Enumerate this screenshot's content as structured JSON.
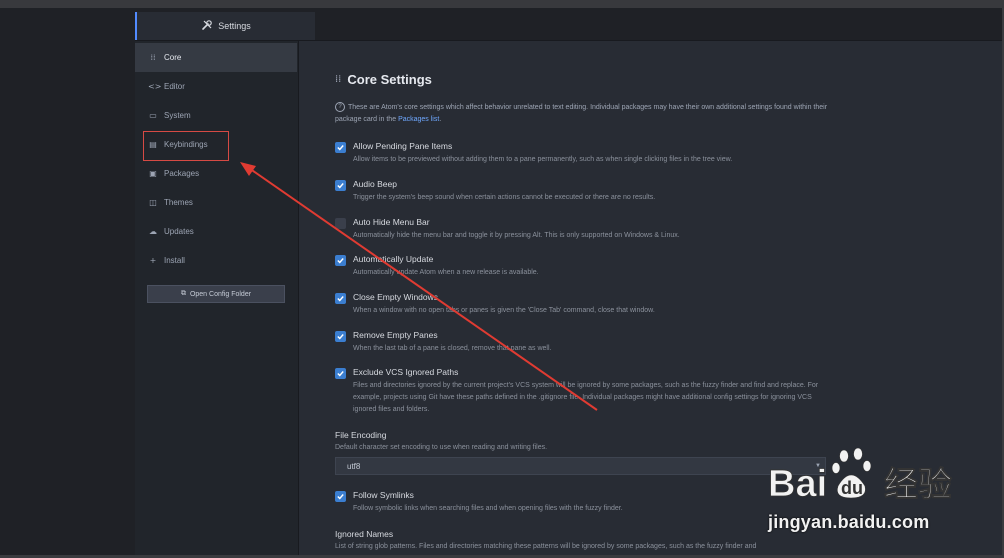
{
  "tab": {
    "label": "Settings"
  },
  "sidebar": {
    "items": [
      {
        "label": "Core",
        "icon": "sliders-icon"
      },
      {
        "label": "Editor",
        "icon": "code-icon"
      },
      {
        "label": "System",
        "icon": "device-desktop-icon"
      },
      {
        "label": "Keybindings",
        "icon": "keyboard-icon"
      },
      {
        "label": "Packages",
        "icon": "package-icon"
      },
      {
        "label": "Themes",
        "icon": "paintcan-icon"
      },
      {
        "label": "Updates",
        "icon": "cloud-download-icon"
      },
      {
        "label": "Install",
        "icon": "plus-icon"
      }
    ],
    "open_config_label": "Open Config Folder"
  },
  "main": {
    "title": "Core Settings",
    "intro_text": "These are Atom's core settings which affect behavior unrelated to text editing. Individual packages may have their own additional settings found within their package card in the",
    "intro_link": "Packages list",
    "intro_end": ".",
    "settings": [
      {
        "title": "Allow Pending Pane Items",
        "checked": true,
        "desc": "Allow items to be previewed without adding them to a pane permanently, such as when single clicking files in the tree view."
      },
      {
        "title": "Audio Beep",
        "checked": true,
        "desc": "Trigger the system's beep sound when certain actions cannot be executed or there are no results."
      },
      {
        "title": "Auto Hide Menu Bar",
        "checked": false,
        "desc": "Automatically hide the menu bar and toggle it by pressing Alt. This is only supported on Windows & Linux."
      },
      {
        "title": "Automatically Update",
        "checked": true,
        "desc": "Automatically update Atom when a new release is available."
      },
      {
        "title": "Close Empty Windows",
        "checked": true,
        "desc": "When a window with no open tabs or panes is given the 'Close Tab' command, close that window."
      },
      {
        "title": "Remove Empty Panes",
        "checked": true,
        "desc": "When the last tab of a pane is closed, remove that pane as well."
      },
      {
        "title": "Exclude VCS Ignored Paths",
        "checked": true,
        "desc": "Files and directories ignored by the current project's VCS system will be ignored by some packages, such as the fuzzy finder and find and replace. For example, projects using Git have these paths defined in the .gitignore file. Individual packages might have additional config settings for ignoring VCS ignored files and folders."
      }
    ],
    "file_encoding": {
      "title": "File Encoding",
      "desc": "Default character set encoding to use when reading and writing files.",
      "value": "utf8"
    },
    "follow_symlinks": {
      "title": "Follow Symlinks",
      "checked": true,
      "desc": "Follow symbolic links when searching files and when opening files with the fuzzy finder."
    },
    "ignored_names": {
      "title": "Ignored Names",
      "desc": "List of string glob patterns. Files and directories matching these patterns will be ignored by some packages, such as the fuzzy finder and"
    }
  },
  "watermark": {
    "logo_text": "Bai du 经验",
    "url": "jingyan.baidu.com"
  },
  "colors": {
    "accent": "#3b7ed0",
    "highlight_box": "#d64a44",
    "annotation_arrow": "#e03b32"
  }
}
